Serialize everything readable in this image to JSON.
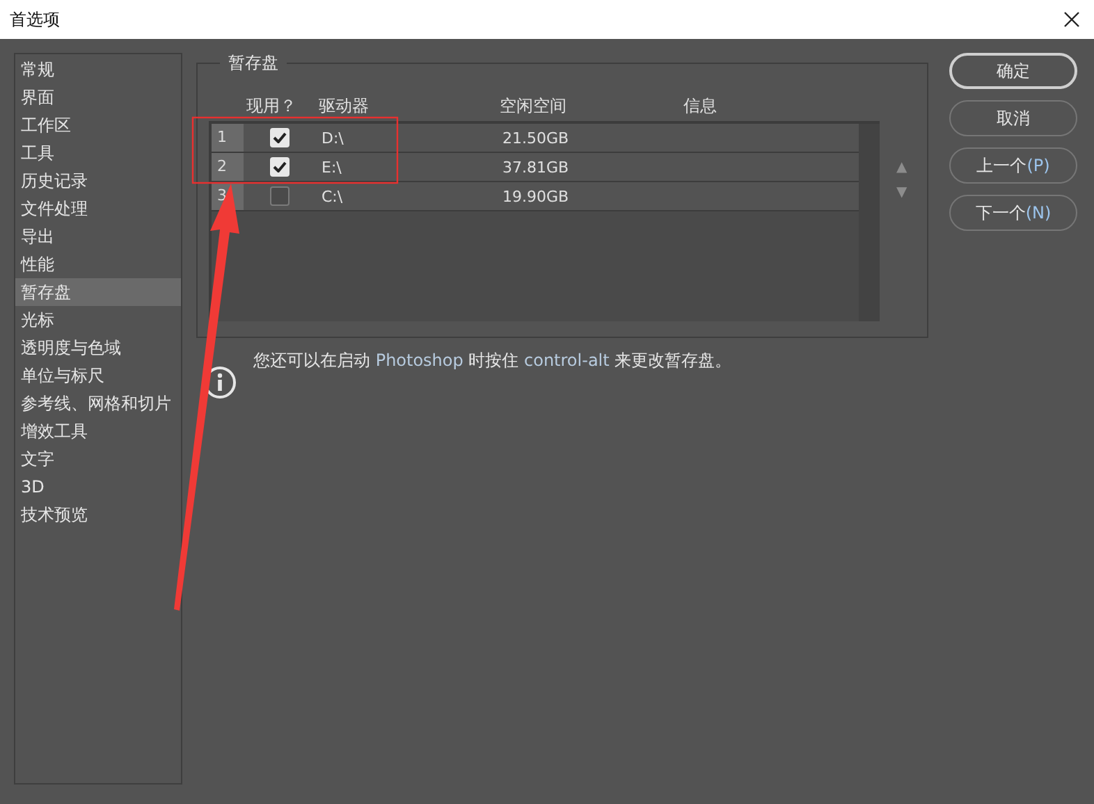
{
  "window": {
    "title": "首选项"
  },
  "sidebar": {
    "items": [
      {
        "label": "常规",
        "selected": false
      },
      {
        "label": "界面",
        "selected": false
      },
      {
        "label": "工作区",
        "selected": false
      },
      {
        "label": "工具",
        "selected": false
      },
      {
        "label": "历史记录",
        "selected": false
      },
      {
        "label": "文件处理",
        "selected": false
      },
      {
        "label": "导出",
        "selected": false
      },
      {
        "label": "性能",
        "selected": false
      },
      {
        "label": "暂存盘",
        "selected": true
      },
      {
        "label": "光标",
        "selected": false
      },
      {
        "label": "透明度与色域",
        "selected": false
      },
      {
        "label": "单位与标尺",
        "selected": false
      },
      {
        "label": "参考线、网格和切片",
        "selected": false
      },
      {
        "label": "增效工具",
        "selected": false
      },
      {
        "label": "文字",
        "selected": false
      },
      {
        "label": "3D",
        "selected": false
      },
      {
        "label": "技术预览",
        "selected": false
      }
    ]
  },
  "scratch_disks": {
    "title": "暂存盘",
    "columns": [
      "现用？",
      "驱动器",
      "空闲空间",
      "信息"
    ],
    "rows": [
      {
        "index": "1",
        "checked": true,
        "drive": "D:\\",
        "free": "21.50GB"
      },
      {
        "index": "2",
        "checked": true,
        "drive": "E:\\",
        "free": "37.81GB"
      },
      {
        "index": "3",
        "checked": false,
        "drive": "C:\\",
        "free": "19.90GB"
      }
    ],
    "move_up": "▲",
    "move_down": "▼"
  },
  "info_text": [
    {
      "kind": "plain",
      "text": "您还可以在启动 "
    },
    {
      "kind": "key",
      "text": "Photoshop"
    },
    {
      "kind": "plain",
      "text": " 时按住 "
    },
    {
      "kind": "key",
      "text": "control-alt"
    },
    {
      "kind": "plain",
      "text": " 来更改暂存盘。"
    }
  ],
  "buttons": [
    {
      "label": "确定",
      "default": true
    },
    {
      "label": "取消",
      "default": false
    },
    {
      "label": "上一个",
      "mnemonic": "(P)",
      "default": false
    },
    {
      "label": "下一个",
      "mnemonic": "(N)",
      "default": false
    }
  ]
}
